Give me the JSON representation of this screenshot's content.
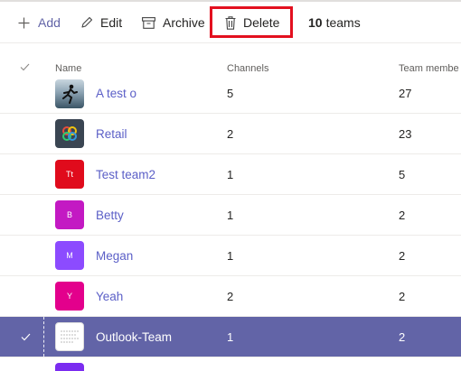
{
  "toolbar": {
    "add_label": "Add",
    "edit_label": "Edit",
    "archive_label": "Archive",
    "delete_label": "Delete",
    "count_number": "10",
    "count_suffix": "teams",
    "highlight_color": "#e3101f"
  },
  "table": {
    "columns": {
      "name": "Name",
      "channels": "Channels",
      "members": "Team membe"
    },
    "rows": [
      {
        "name": "A test o",
        "channels": "5",
        "members": "27",
        "avatar_text": "",
        "avatar_color": "#3b5566",
        "avatar_kind": "photo"
      },
      {
        "name": "Retail",
        "channels": "2",
        "members": "23",
        "avatar_text": "",
        "avatar_color": "#3a4552",
        "avatar_kind": "logo"
      },
      {
        "name": "Test team2",
        "channels": "1",
        "members": "5",
        "avatar_text": "Tt",
        "avatar_color": "#e00b1c",
        "avatar_kind": "initials"
      },
      {
        "name": "Betty",
        "channels": "1",
        "members": "2",
        "avatar_text": "B",
        "avatar_color": "#c319c3",
        "avatar_kind": "initials"
      },
      {
        "name": "Megan",
        "channels": "1",
        "members": "2",
        "avatar_text": "M",
        "avatar_color": "#8c4bff",
        "avatar_kind": "initials"
      },
      {
        "name": "Yeah",
        "channels": "2",
        "members": "2",
        "avatar_text": "Y",
        "avatar_color": "#e3008c",
        "avatar_kind": "initials"
      },
      {
        "name": "Outlook-Team",
        "channels": "1",
        "members": "2",
        "avatar_text": "",
        "avatar_color": "#ffffff",
        "avatar_kind": "document",
        "selected": true
      }
    ]
  },
  "colors": {
    "accent": "#6264a7",
    "link": "#5b5fc7"
  }
}
